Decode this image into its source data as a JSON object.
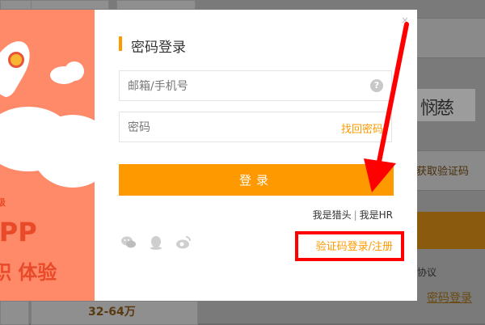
{
  "background": {
    "get_code_label": "获取验证码",
    "agreement_fragment": "协议",
    "password_login_link": "密码登录",
    "salary_fragment": "32-64万",
    "captcha_text": "悯慈"
  },
  "promo": {
    "line1": "APP",
    "line2": "职 体验",
    "small": "级"
  },
  "modal": {
    "title": "密码登录",
    "close_symbol": "×",
    "account_placeholder": "邮箱/手机号",
    "password_placeholder": "密码",
    "help_symbol": "?",
    "forgot_label": "找回密码",
    "login_label": "登录",
    "role_headhunter": "我是猎头",
    "role_separator": "|",
    "role_hr": "我是HR",
    "sms_login_label": "验证码登录/注册"
  },
  "colors": {
    "accent": "#ff9900",
    "annotation": "#ff0000",
    "promo": "#ff8a6a"
  },
  "icons": [
    "wechat-icon",
    "qq-icon",
    "weibo-icon"
  ]
}
